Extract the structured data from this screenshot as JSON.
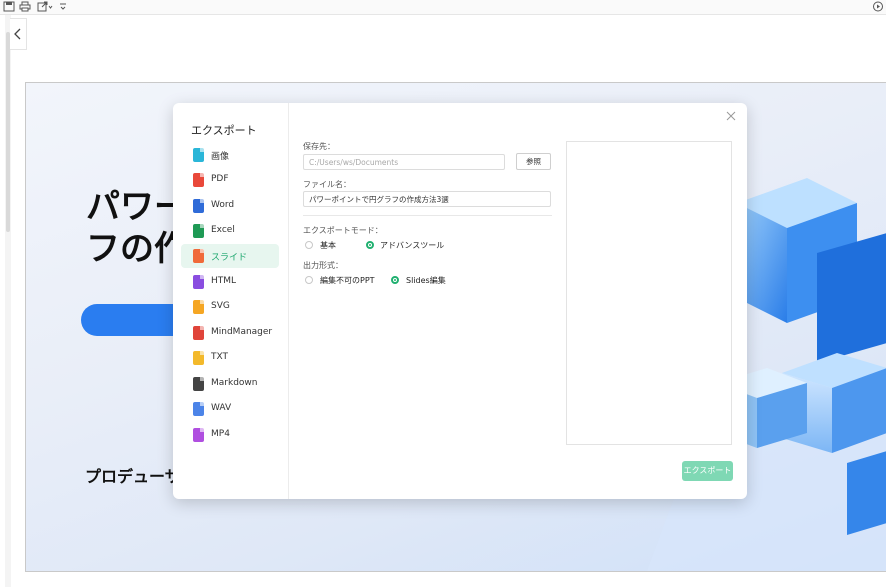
{
  "dialog": {
    "title": "エクスポート",
    "formats": [
      {
        "label": "画像",
        "color": "#2ab6d8"
      },
      {
        "label": "PDF",
        "color": "#e9483a"
      },
      {
        "label": "Word",
        "color": "#2f6bd8"
      },
      {
        "label": "Excel",
        "color": "#1e9a55"
      },
      {
        "label": "スライド",
        "color": "#f06a3a",
        "active": true
      },
      {
        "label": "HTML",
        "color": "#8a4de0"
      },
      {
        "label": "SVG",
        "color": "#f5a623"
      },
      {
        "label": "MindManager",
        "color": "#e0443a"
      },
      {
        "label": "TXT",
        "color": "#f3b92b"
      },
      {
        "label": "Markdown",
        "color": "#444444"
      },
      {
        "label": "WAV",
        "color": "#4c84e8"
      },
      {
        "label": "MP4",
        "color": "#b04fe0"
      }
    ],
    "save_location": {
      "label": "保存先：",
      "placeholder": "C:/Users/ws/Documents",
      "browse_label": "参照"
    },
    "file_name": {
      "label": "ファイル名：",
      "value": "パワーポイントで円グラフの作成方法3選"
    },
    "export_mode": {
      "label": "エクスポートモード：",
      "options": [
        "基本",
        "アドバンスツール"
      ],
      "selected": 1
    },
    "output_format": {
      "label": "出力形式：",
      "options": [
        "編集不可のPPT",
        "Slides編集"
      ],
      "selected": 1
    },
    "export_button": "エクスポート"
  },
  "slide": {
    "title_partial": "パワー\nフの作",
    "subtitle_partial": "プロデューサ"
  },
  "icons": [
    "save-icon",
    "print-icon",
    "share-icon",
    "more-icon",
    "play-circle-icon",
    "chevron-left-icon",
    "close-icon"
  ]
}
